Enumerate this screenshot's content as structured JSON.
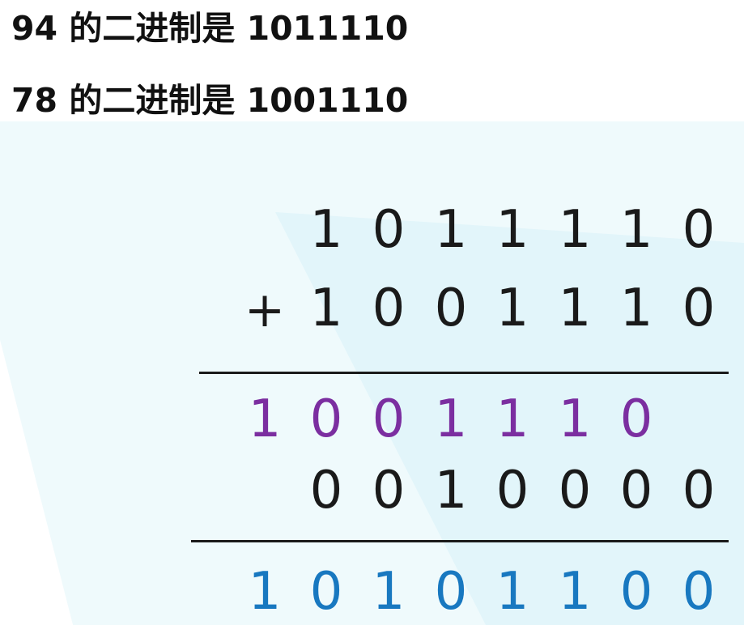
{
  "headings": [
    "94 的二进制是 1011110",
    "78 的二进制是 1001110"
  ],
  "operator": "+",
  "rows": [
    {
      "digits": [
        "1",
        "0",
        "1",
        "1",
        "1",
        "1",
        "0"
      ],
      "start_col": 1,
      "color": "#1a1a1a"
    },
    {
      "digits": [
        "1",
        "0",
        "0",
        "1",
        "1",
        "1",
        "0"
      ],
      "start_col": 1,
      "color": "#1a1a1a"
    },
    {
      "digits": [
        "1",
        "0",
        "0",
        "1",
        "1",
        "1",
        "0"
      ],
      "start_col": 0,
      "color": "#7b2ea0"
    },
    {
      "digits": [
        "0",
        "0",
        "1",
        "0",
        "0",
        "0",
        "0"
      ],
      "start_col": 1,
      "color": "#1a1a1a"
    },
    {
      "digits": [
        "1",
        "0",
        "1",
        "0",
        "1",
        "1",
        "0",
        "0"
      ],
      "start_col": 0,
      "color": "#1878c0"
    }
  ],
  "colors": {
    "text": "#111111",
    "carry_row": "#7b2ea0",
    "result_row": "#1878c0",
    "background_tint": "#e8f7fb"
  }
}
